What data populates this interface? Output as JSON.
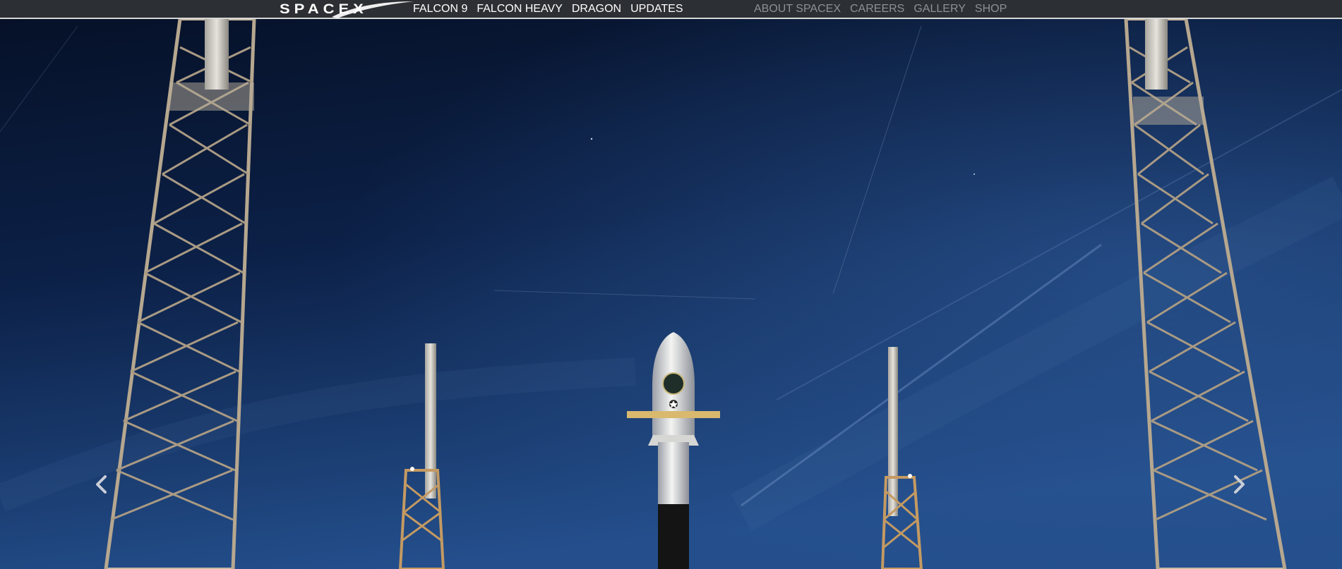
{
  "logo": {
    "text": "SPACEX",
    "icon": "spacex-logo-swoosh"
  },
  "nav": {
    "primary": [
      {
        "label": "FALCON 9"
      },
      {
        "label": "FALCON HEAVY"
      },
      {
        "label": "DRAGON"
      },
      {
        "label": "UPDATES"
      }
    ],
    "secondary": [
      {
        "label": "ABOUT SPACEX"
      },
      {
        "label": "CAREERS"
      },
      {
        "label": "GALLERY"
      },
      {
        "label": "SHOP"
      }
    ]
  },
  "hero": {
    "image": "falcon-9-rocket-on-launch-pad-at-night",
    "prev_icon": "chevron-left-icon",
    "next_icon": "chevron-right-icon"
  },
  "colors": {
    "topbar": "#2c2f33",
    "nav_primary_text": "#ffffff",
    "nav_secondary_text": "#8d9096",
    "sky_top": "#081630",
    "sky_bottom": "#24508f"
  }
}
